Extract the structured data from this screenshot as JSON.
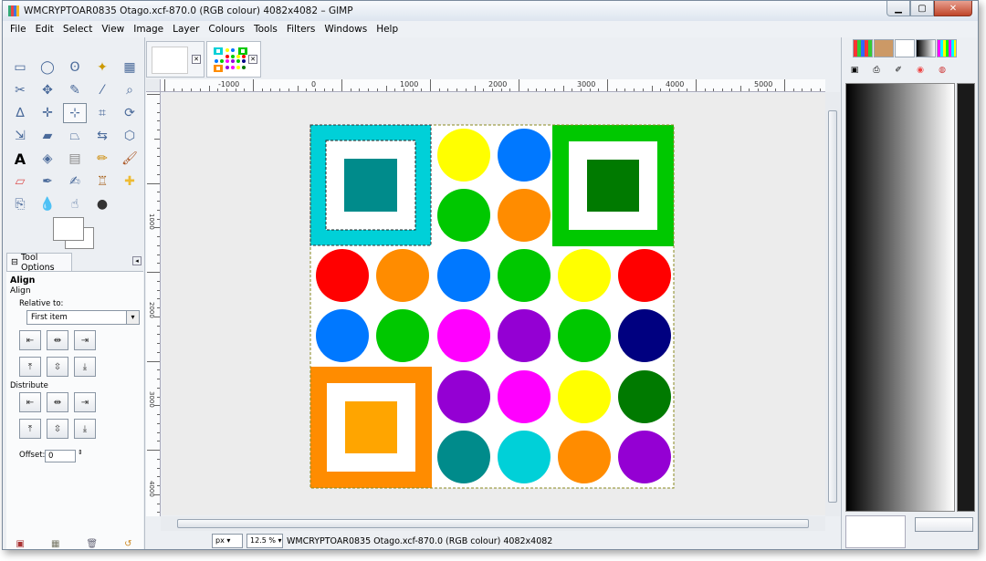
{
  "window": {
    "title": "WMCRYPTOAR0835 Otago.xcf-870.0 (RGB colour) 4082x4082 – GIMP",
    "min_icon": "minimize-icon",
    "max_icon": "maximize-icon",
    "close_icon": "close-icon"
  },
  "menu": [
    "File",
    "Edit",
    "Select",
    "View",
    "Image",
    "Layer",
    "Colours",
    "Tools",
    "Filters",
    "Windows",
    "Help"
  ],
  "tool_options": {
    "tab_label": "Tool Options",
    "heading": "Align",
    "subheading": "Align",
    "relative_to_label": "Relative to:",
    "relative_to_value": "First item",
    "distribute_label": "Distribute",
    "offset_label": "Offset:",
    "offset_value": "0"
  },
  "ruler": {
    "h_labels": [
      "-1000",
      "0",
      "1000",
      "2000",
      "3000",
      "4000",
      "5000"
    ],
    "v_labels": [
      "1000",
      "2000",
      "3000",
      "4000"
    ]
  },
  "status": {
    "unit": "px",
    "zoom": "12.5 %",
    "text": "WMCRYPTOAR0835 Otago.xcf-870.0 (RGB colour) 4082x4082"
  },
  "colors": {
    "cyan": "#00d0d8",
    "teal": "#008b8b",
    "green": "#00c800",
    "darkgreen": "#007a00",
    "orange": "#ff8c00",
    "lightorange": "#ffa500",
    "yellow": "#ffff00",
    "blue": "#0078ff",
    "red": "#ff0000",
    "magenta": "#ff00ff",
    "purple": "#9400d3",
    "navy": "#000080"
  },
  "image": {
    "circles": [
      {
        "color": "yellow"
      },
      {
        "color": "blue"
      },
      {
        "color": "green"
      },
      {
        "color": "orange"
      },
      {
        "color": "red"
      },
      {
        "color": "orange"
      },
      {
        "color": "blue"
      },
      {
        "color": "green"
      },
      {
        "color": "yellow"
      },
      {
        "color": "red"
      },
      {
        "color": "blue"
      },
      {
        "color": "green"
      },
      {
        "color": "magenta"
      },
      {
        "color": "purple"
      },
      {
        "color": "green"
      },
      {
        "color": "navy"
      },
      {
        "color": "purple"
      },
      {
        "color": "magenta"
      },
      {
        "color": "yellow"
      },
      {
        "color": "darkgreen"
      },
      {
        "color": "teal"
      },
      {
        "color": "cyan"
      },
      {
        "color": "orange"
      },
      {
        "color": "purple"
      }
    ]
  }
}
